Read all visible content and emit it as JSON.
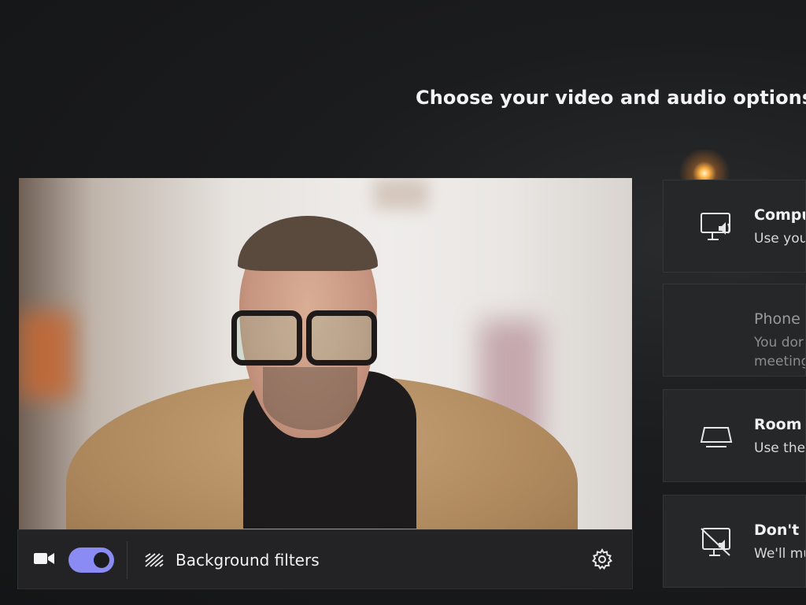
{
  "header": {
    "title": "Choose your video and audio options"
  },
  "preview": {
    "alt": "Camera preview"
  },
  "toolbar": {
    "camera_icon": "video-camera-icon",
    "camera_on": true,
    "background_filters_label": "Background filters",
    "background_icon": "background-effects-icon",
    "settings_icon": "gear-icon"
  },
  "audio_options": [
    {
      "title": "Compu",
      "desc_lines": [
        "Use you"
      ],
      "icon": "computer-audio-icon",
      "enabled": true
    },
    {
      "title": "Phone",
      "desc_lines": [
        "You dor",
        "meeting"
      ],
      "icon": "phone-audio-icon",
      "enabled": false
    },
    {
      "title": "Room",
      "desc_lines": [
        "Use the"
      ],
      "icon": "room-audio-icon",
      "enabled": true
    },
    {
      "title": "Don't u",
      "desc_lines": [
        "We'll mu"
      ],
      "icon": "no-audio-icon",
      "enabled": true
    }
  ],
  "colors": {
    "accent": "#8b8cf3",
    "panel": "#232325",
    "background": "#151617"
  }
}
